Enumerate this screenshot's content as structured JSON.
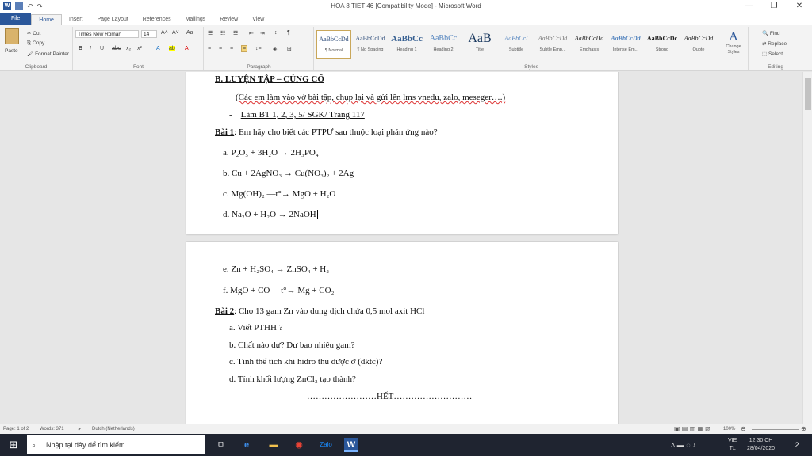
{
  "window": {
    "title": "HOA 8 TIET 46 [Compatibility Mode] - Microsoft Word",
    "minimize": "—",
    "maximize": "❐",
    "close": "✕"
  },
  "tabs": [
    "File",
    "Home",
    "Insert",
    "Page Layout",
    "References",
    "Mailings",
    "Review",
    "View"
  ],
  "ribbon": {
    "clipboard": {
      "paste": "Paste",
      "cut": "Cut",
      "copy": "Copy",
      "format_painter": "Format Painter",
      "label": "Clipboard"
    },
    "font": {
      "name": "Times New Roman",
      "size": "14",
      "label": "Font"
    },
    "paragraph": {
      "label": "Paragraph"
    },
    "styles": {
      "label": "Styles",
      "items": [
        {
          "sample": "AaBbCcDd",
          "name": "¶ Normal"
        },
        {
          "sample": "AaBbCcDd",
          "name": "¶ No Spacing"
        },
        {
          "sample": "AaBbCc",
          "name": "Heading 1"
        },
        {
          "sample": "AaBbCc",
          "name": "Heading 2"
        },
        {
          "sample": "AaB",
          "name": "Title"
        },
        {
          "sample": "AaBbCcI",
          "name": "Subtitle"
        },
        {
          "sample": "AaBbCcDd",
          "name": "Subtle Emp..."
        },
        {
          "sample": "AaBbCcDd",
          "name": "Emphasis"
        },
        {
          "sample": "AaBbCcDd",
          "name": "Intense Em..."
        },
        {
          "sample": "AaBbCcDc",
          "name": "Strong"
        },
        {
          "sample": "AaBbCcDd",
          "name": "Quote"
        }
      ],
      "change_styles": "Change Styles"
    },
    "editing": {
      "find": "Find",
      "replace": "Replace",
      "select": "Select",
      "label": "Editing"
    }
  },
  "document": {
    "heading": "B. LUYỆN TẬP – CỦNG CỐ",
    "instruction": "(Các em làm vào vở bài tập, chụp lại và gửi lên lms vnedu, zalo, meseger….)",
    "task": "Làm BT 1, 2, 3, 5/ SGK/ Trang 117",
    "task_bullet": "-",
    "bai1_label": "Bài 1",
    "bai1_text": ": Em hãy cho biết các PTPƯ sau thuộc loại phản ứng nào?",
    "eq": [
      "a. P₂O₅ + 3H₂O → 2H₃PO₄",
      "b. Cu   + 2AgNO₃ → Cu(NO₃)₂ + 2Ag",
      "c. Mg(OH)₂ —t°→ MgO + H₂O",
      "d. Na₂O + H₂O → 2NaOH",
      "e. Zn + H₂SO₄ → ZnSO₄ + H₂",
      "f. MgO + CO —t°→ Mg + CO₂"
    ],
    "bai2_label": "Bài 2",
    "bai2_text": ": Cho 13 gam Zn vào dung dịch chứa 0,5 mol axit HCl",
    "bai2_items": [
      "a.   Viết PTHH ?",
      "b.   Chất nào dư? Dư bao nhiêu gam?",
      "c.   Tính thể tích khí hidro thu được ở (đktc)?",
      "d.   Tính khối lượng ZnCl₂ tạo thành?"
    ],
    "end": "……………………HẾT………………………"
  },
  "status": {
    "page": "Page: 1 of 2",
    "words": "Words: 371",
    "language": "Dutch (Netherlands)",
    "zoom": "100%"
  },
  "taskbar": {
    "search_placeholder": "Nhập tại đây để tìm kiếm",
    "lang_top": "VIE",
    "lang_bottom": "TL",
    "time": "12:30 CH",
    "date": "28/04/2020",
    "notif": "2"
  }
}
